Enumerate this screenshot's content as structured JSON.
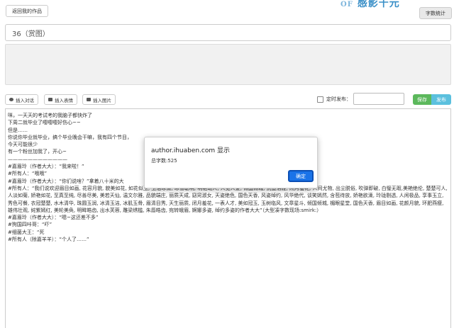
{
  "header": {
    "back_label": "返回我的作品",
    "logo_text": "感影千元",
    "wordcount_label": "字数统计"
  },
  "form": {
    "title_value": "36（赏图）",
    "toolbar": {
      "insert_dialog": "插入对话",
      "insert_emoji": "插入表情",
      "insert_image": "插入图片",
      "timed_label": "定时发布：",
      "save_label": "保存",
      "publish_label": "发布"
    }
  },
  "editor": {
    "lines": [
      "咪，一天天的考试考的我脑子都快炸了",
      "下周二就毕业了嘤嘤嘤好伤心~~",
      "但是……",
      "你说你毕业就毕业，搞个毕业晚会干嘛，我有四个节目，",
      "今天可能很少",
      "有一个粉丝加我了，开心~",
      "————————————",
      "#嘉眉玲（作者大大）：“我来啦！”",
      "#所有人：“哦哦”",
      "#嘉眉玲（作者大大）：“你们说啥？”拿着八十米的大",
      "#所有人：“我们说欢迎眉目如画, 花容月貌, 貌美如花, 如花似玉, 玉洁冰清, 冰雪聪明, 明艳动人, 人见人爱, 倾国倾城, 沉鱼落雁, 闭月羞花, 人间尤物, 出尘脱俗, 吹弹即破, 白璧无瑕,美艳绝伦, 楚楚可人, 人淡如菊, 娇艳如花, 至真至纯, 尽善尽美, 美若天仙, 温文尔雅, 品貌端庄, 丽质天成, 窈窕淑女, 天姿绝色, 国色天香, 风姿绰约, 风华绝代, 谈笑嫣然, 含苞待放, 娇艳欲滴, 玲珑剔透, 人闲极品, 享事玉立, 秀色可餐, 衣冠楚楚, 水木清华, 珠圆玉润, 冰清玉洁, 冰肌玉骨, 眉清目秀, 天生丽质, 闭月羞花, 一表人才, 美如冠玉, 玉树临风, 文章星斗, 倾国倾城, 楣眼星堂, 国色天香, 眉目如画, 花颜月貌, 环肥燕瘦, 雄伟壮观, 姹紫嫣红, 美轮美奂, 明眸皓齿, 出水芙蓉, 雕梁绣槛, 朱唇皓齿, 宛转蛾眉, 婀娜多姿, 绰约多姿的作者大大”（大型凑字数现场:smirk:）",
      "#嘉眉玲（作者大大）：“嗯~这还差不多”",
      "#狗国四咔哥：“吓”",
      "#细菌大王：“死",
      "#所有人（除嘉羊羊）：“个人了……”"
    ]
  },
  "alert": {
    "title": "author.ihuaben.com 显示",
    "message": "总字数:525",
    "ok_label": "确定"
  },
  "colors": {
    "save": "#5cb85c",
    "publish": "#5bc0de",
    "ok_button": "#1a73e8"
  }
}
